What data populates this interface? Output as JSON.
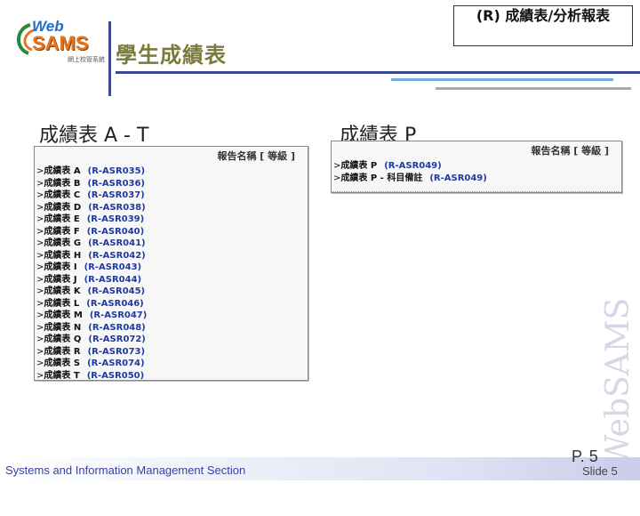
{
  "logo": {
    "web": "Web",
    "sams": "SAMS",
    "subtitle": "網上校管系統"
  },
  "header": {
    "title": "學生成績表",
    "reference_title": "(R)  成績表/分析報表"
  },
  "sections": [
    {
      "label": "成績表 A - T"
    },
    {
      "label": "成績表 P"
    }
  ],
  "panel_a": {
    "header": "報告名稱 [ 等級 ]",
    "rows": [
      {
        "name": "成績表 A",
        "code": "(R-ASR035)"
      },
      {
        "name": "成績表 B",
        "code": "(R-ASR036)"
      },
      {
        "name": "成績表 C",
        "code": "(R-ASR037)"
      },
      {
        "name": "成績表 D",
        "code": "(R-ASR038)"
      },
      {
        "name": "成績表 E",
        "code": "(R-ASR039)"
      },
      {
        "name": "成績表 F",
        "code": "(R-ASR040)"
      },
      {
        "name": "成績表 G",
        "code": "(R-ASR041)"
      },
      {
        "name": "成績表 H",
        "code": "(R-ASR042)"
      },
      {
        "name": "成績表 I",
        "code": "(R-ASR043)"
      },
      {
        "name": "成績表 J",
        "code": "(R-ASR044)"
      },
      {
        "name": "成績表 K",
        "code": "(R-ASR045)"
      },
      {
        "name": "成績表 L",
        "code": "(R-ASR046)"
      },
      {
        "name": "成績表 M",
        "code": "(R-ASR047)"
      },
      {
        "name": "成績表 N",
        "code": "(R-ASR048)"
      },
      {
        "name": "成績表 Q",
        "code": "(R-ASR072)"
      },
      {
        "name": "成績表 R",
        "code": "(R-ASR073)"
      },
      {
        "name": "成績表 S",
        "code": "(R-ASR074)"
      },
      {
        "name": "成績表 T",
        "code": "(R-ASR050)"
      }
    ]
  },
  "panel_p": {
    "header": "報告名稱 [ 等級 ]",
    "rows": [
      {
        "name": "成績表 P",
        "code": "(R-ASR049)"
      },
      {
        "name": "成績表 P - 科目備註",
        "code": "(R-ASR049)"
      }
    ]
  },
  "footer": {
    "org": "Systems and Information Management Section",
    "page": "P. 5",
    "slide": "Slide 5",
    "watermark": "WebSAMS"
  }
}
